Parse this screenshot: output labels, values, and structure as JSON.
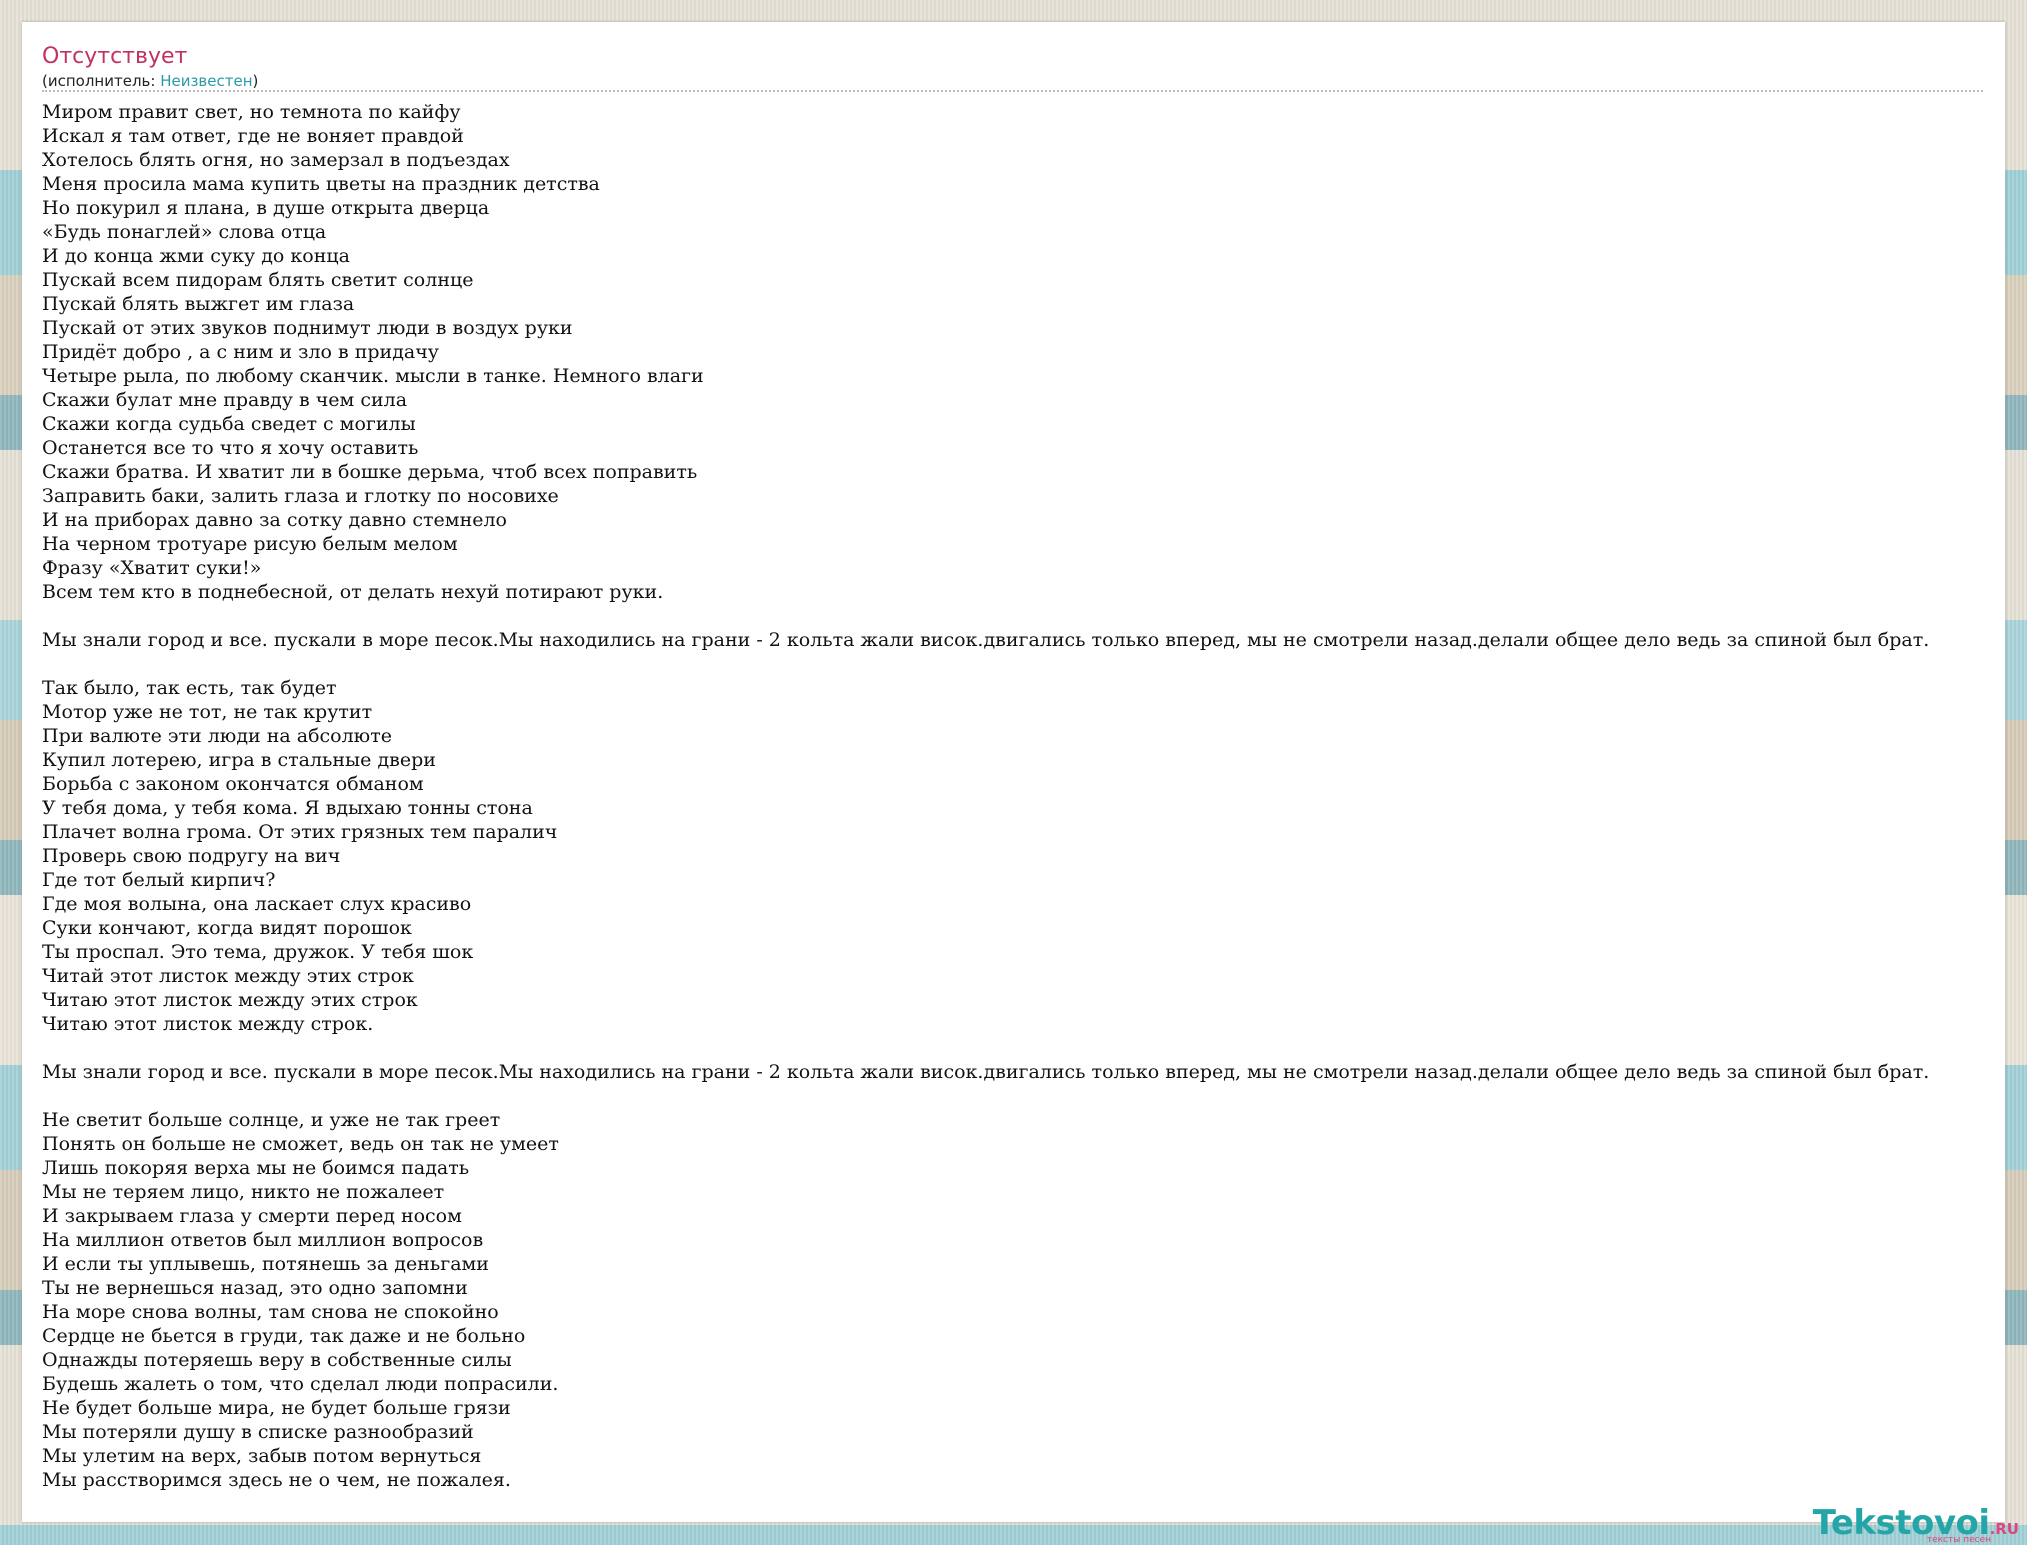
{
  "song": {
    "title": "Отсутствует",
    "artist_prefix": "(исполнитель: ",
    "artist": "Неизвестен",
    "artist_suffix": ")",
    "lyrics": [
      "Миром правит свет, но темнота по кайфу",
      "Искал я там ответ, где не воняет правдой",
      "Хотелось блять огня, но замерзал в подъездах",
      "Меня просила мама купить цветы на праздник детства",
      "Но покурил я плана, в душе открыта дверца",
      "«Будь понаглей» слова отца",
      "И до конца жми суку до конца",
      "Пускай всем пидорам блять светит солнце",
      "Пускай блять выжгет им глаза",
      "Пускай от этих звуков поднимут люди в воздух руки",
      "Придёт добро , а с ним и зло в придачу",
      "Четыре рыла, по любому сканчик. мысли в танке. Немного влаги",
      "Скажи булат мне правду в чем сила",
      "Скажи когда судьба сведет с могилы",
      "Останется все то что я хочу оставить",
      "Скажи братва. И хватит ли в бошке дерьма, чтоб всех поправить",
      "Заправить баки, залить глаза и глотку по носовихе",
      "И на приборах давно за сотку давно стемнело",
      "На черном тротуаре рисую белым мелом",
      "Фразу «Хватит суки!»",
      "Всем тем кто в поднебесной, от делать нехуй потирают руки.",
      "",
      "Мы знали город и все. пускали в море песок.Мы находились на грани - 2 кольта жали висок.двигались только вперед, мы не смотрели назад.делали общее дело ведь за спиной был брат.",
      "",
      "Так было, так есть, так будет",
      "Мотор уже не тот, не так крутит",
      "При валюте эти люди на абсолюте",
      "Купил лотерею, игра в стальные двери",
      "Борьба с законом окончатся обманом",
      "У тебя дома, у тебя кома. Я вдыхаю тонны стона",
      "Плачет волна грома. От этих грязных тем паралич",
      "Проверь свою подругу на вич",
      "Где тот белый кирпич?",
      "Где моя волына, она ласкает слух красиво",
      "Суки кончают, когда видят порошок",
      "Ты проспал. Это тема, дружок. У тебя шок",
      "Читай этот листок между этих строк",
      "Читаю этот листок между этих строк",
      "Читаю этот листок между строк.",
      "",
      "Мы знали город и все. пускали в море песок.Мы находились на грани - 2 кольта жали висок.двигались только вперед, мы не смотрели назад.делали общее дело ведь за спиной был брат.",
      "",
      "Не светит больше солнце, и уже не так греет",
      "Понять он больше не сможет, ведь он так не умеет",
      "Лишь покоряя верха мы не боимся падать",
      "Мы не теряем лицо, никто не пожалеет",
      "И закрываем глаза у смерти перед носом",
      "На миллион ответов был миллион вопросов",
      "И если ты уплывешь, потянешь за деньгами",
      "Ты не вернешься назад, это одно запомни",
      "На море снова волны, там снова не спокойно",
      "Сердце не бьется в груди, так даже и не больно",
      "Однажды потеряешь веру в собственные силы",
      "Будешь жалеть о том, что сделал люди попрасили.",
      "Не будет больше мира, не будет больше грязи",
      "Мы потеряли душу в списке разнообразий",
      "Мы улетим на верх, забыв потом вернуться",
      "Мы расстворимся здесь не о чем, не пожалея."
    ]
  },
  "logo": {
    "name": "Tekstovoi",
    "tld": ".RU",
    "tagline": "тексты песен"
  },
  "colors": {
    "title": "#c2325f",
    "link": "#2a9aa8",
    "logo": "#24a6a8",
    "logo_accent": "#e0457d"
  }
}
